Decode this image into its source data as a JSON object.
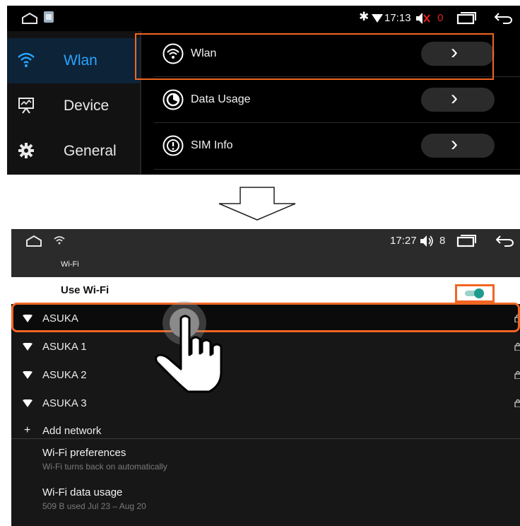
{
  "screen1": {
    "status": {
      "time": "17:13",
      "volume_value": "0",
      "icons": [
        "home-icon",
        "photo-icon",
        "bluetooth-icon",
        "wifi-signal-icon",
        "volume-mute-icon",
        "recent-apps-icon",
        "back-icon"
      ]
    },
    "sidebar": {
      "items": [
        {
          "label": "Wlan",
          "icon": "wifi-icon",
          "active": true
        },
        {
          "label": "Device",
          "icon": "monitor-icon",
          "active": false
        },
        {
          "label": "General",
          "icon": "gear-icon",
          "active": false
        }
      ]
    },
    "rows": [
      {
        "label": "Wlan",
        "icon": "wifi-circle-icon",
        "action": "›"
      },
      {
        "label": "Data Usage",
        "icon": "data-usage-icon",
        "action": "›"
      },
      {
        "label": "SIM Info",
        "icon": "sim-info-icon",
        "action": "›"
      }
    ],
    "colors": {
      "highlight": "#f26522",
      "accent": "#2aa5ff",
      "muted_volume": "#e02020"
    }
  },
  "screen2": {
    "status": {
      "time": "17:27",
      "volume_value": "8",
      "icons": [
        "home-icon",
        "wifi-icon",
        "volume-icon",
        "recent-apps-icon",
        "back-icon"
      ]
    },
    "title": "Wi-Fi",
    "use_wifi": {
      "label": "Use Wi-Fi",
      "enabled": true
    },
    "networks": [
      {
        "name": "ASUKA",
        "secured": true,
        "highlighted": true
      },
      {
        "name": "ASUKA 1",
        "secured": true,
        "highlighted": false
      },
      {
        "name": "ASUKA 2",
        "secured": true,
        "highlighted": false
      },
      {
        "name": "ASUKA 3",
        "secured": true,
        "highlighted": false
      }
    ],
    "add_network": {
      "symbol": "+",
      "label": "Add network"
    },
    "preferences": {
      "title": "Wi-Fi preferences",
      "subtitle": "Wi-Fi turns back on automatically"
    },
    "data_usage": {
      "title": "Wi-Fi data usage",
      "subtitle": "509 B used Jul 23 – Aug 20"
    },
    "colors": {
      "toggle_on": "#1e9c8c",
      "highlight": "#f26522"
    }
  }
}
